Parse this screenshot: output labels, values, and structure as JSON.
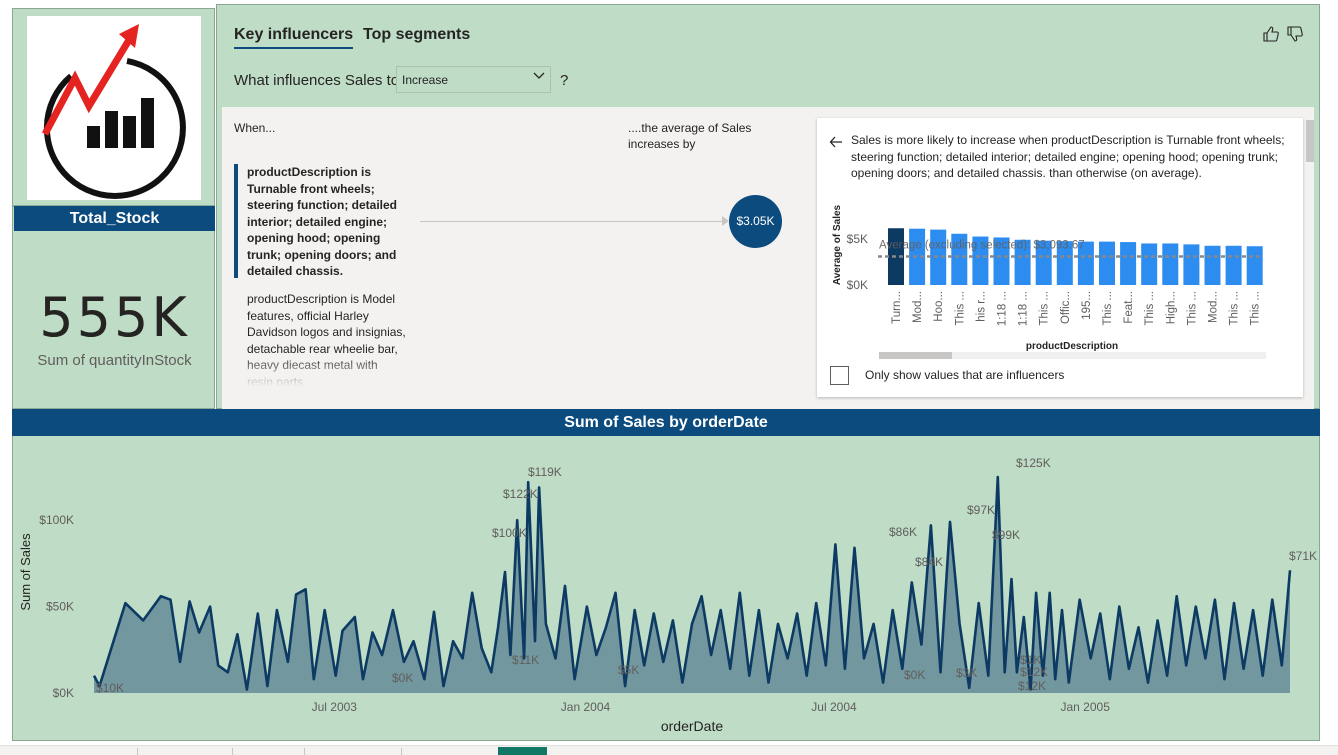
{
  "total_stock": {
    "title": "Total_Stock",
    "value": "555K",
    "label": "Sum of quantityInStock"
  },
  "key_influencers": {
    "tabs": [
      {
        "label": "Key influencers"
      },
      {
        "label": "Top segments"
      }
    ],
    "question_prefix": "What influences Sales to",
    "question_suffix": "?",
    "dropdown_value": "Increase",
    "when_label": "When...",
    "avg_label": "....the average of Sales increases by",
    "influencers": [
      {
        "text": "productDescription is Turnable front wheels; steering function; detailed interior; detailed engine; opening hood; opening trunk; opening doors; and detailed chassis.",
        "value": "$3.05K"
      },
      {
        "text": "productDescription is Model features, official Harley Davidson logos and insignias, detachable rear wheelie bar, heavy diecast metal with resin parts"
      }
    ],
    "detail": {
      "text": "Sales is more likely to increase when productDescription is Turnable front wheels; steering function; detailed interior; detailed engine; opening hood; opening trunk; opening doors; and detailed chassis. than otherwise (on average).",
      "checkbox_label": "Only show values that are influencers"
    }
  },
  "sales_chart": {
    "title": "Sum of Sales by orderDate"
  },
  "chart_data": [
    {
      "type": "bar",
      "ylabel": "Average of Sales",
      "xlabel": "productDescription",
      "ylim": [
        0,
        6500
      ],
      "yticks": [
        "$0K",
        "$5K"
      ],
      "reference_line": {
        "label": "Average (excluding selected): $3,093.67",
        "value": 3093.67
      },
      "categories": [
        "Turn...",
        "Mod...",
        "Hoo...",
        "This ...",
        "his r...",
        "1:18 ...",
        "1:18 ...",
        "This ...",
        "Offic...",
        "195...",
        "This ...",
        "Feat...",
        "This ...",
        "High...",
        "This ...",
        "Mod...",
        "This ...",
        "This ..."
      ],
      "values": [
        6150,
        6100,
        6000,
        5550,
        5250,
        5150,
        4900,
        4800,
        4750,
        4700,
        4700,
        4650,
        4500,
        4500,
        4400,
        4250,
        4250,
        4200
      ],
      "highlighted_index": 0,
      "colors": {
        "highlight": "#0c3a63",
        "bar": "#2d8cf0"
      }
    },
    {
      "type": "area",
      "title": "Sum of Sales by orderDate",
      "xlabel": "orderDate",
      "ylabel": "Sum of Sales",
      "ylim": [
        0,
        125000
      ],
      "yticks": [
        "$0K",
        "$50K",
        "$100K"
      ],
      "xticks": [
        "Jul 2003",
        "Jan 2004",
        "Jul 2004",
        "Jan 2005"
      ],
      "x_range": [
        "2003-01-06",
        "2005-05-31"
      ],
      "data_labels": [
        "$10K",
        "$0K",
        "$122K",
        "$119K",
        "$100K",
        "$11K",
        "$5K",
        "$86K",
        "$84K",
        "$97K",
        "$99K",
        "$0K",
        "$3K",
        "$125K",
        "$12K",
        "$12K",
        "$1K",
        "$71K"
      ],
      "series": [
        {
          "x": [
            "2003-01-06",
            "2003-01-10",
            "2003-01-29",
            "2003-02-11",
            "2003-02-24",
            "2003-03-03",
            "2003-03-10",
            "2003-03-17",
            "2003-03-24",
            "2003-04-01",
            "2003-04-07",
            "2003-04-14",
            "2003-04-21",
            "2003-04-28",
            "2003-05-06",
            "2003-05-13",
            "2003-05-20",
            "2003-05-28",
            "2003-06-03",
            "2003-06-10",
            "2003-06-16",
            "2003-06-24",
            "2003-07-02",
            "2003-07-07",
            "2003-07-16",
            "2003-07-22",
            "2003-07-29",
            "2003-08-05",
            "2003-08-13",
            "2003-08-21",
            "2003-08-28",
            "2003-09-05",
            "2003-09-12",
            "2003-09-19",
            "2003-09-26",
            "2003-10-03",
            "2003-10-10",
            "2003-10-17",
            "2003-10-24",
            "2003-10-29",
            "2003-11-03",
            "2003-11-07",
            "2003-11-12",
            "2003-11-17",
            "2003-11-20",
            "2003-11-25",
            "2003-11-28",
            "2003-12-03",
            "2003-12-10",
            "2003-12-17",
            "2003-12-24",
            "2004-01-02",
            "2004-01-09",
            "2004-01-16",
            "2004-01-23",
            "2004-01-30",
            "2004-02-06",
            "2004-02-13",
            "2004-02-20",
            "2004-02-27",
            "2004-03-05",
            "2004-03-12",
            "2004-03-19",
            "2004-03-26",
            "2004-04-02",
            "2004-04-09",
            "2004-04-16",
            "2004-04-23",
            "2004-04-30",
            "2004-05-07",
            "2004-05-14",
            "2004-05-21",
            "2004-05-28",
            "2004-06-04",
            "2004-06-11",
            "2004-06-18",
            "2004-06-25",
            "2004-07-02",
            "2004-07-09",
            "2004-07-16",
            "2004-07-23",
            "2004-07-30",
            "2004-08-06",
            "2004-08-13",
            "2004-08-20",
            "2004-08-27",
            "2004-09-03",
            "2004-09-10",
            "2004-09-17",
            "2004-09-24",
            "2004-10-01",
            "2004-10-08",
            "2004-10-15",
            "2004-10-22",
            "2004-10-29",
            "2004-11-03",
            "2004-11-08",
            "2004-11-12",
            "2004-11-17",
            "2004-11-22",
            "2004-11-26",
            "2004-12-01",
            "2004-12-06",
            "2004-12-10",
            "2004-12-15",
            "2004-12-20",
            "2004-12-28",
            "2005-01-05",
            "2005-01-12",
            "2005-01-19",
            "2005-01-26",
            "2005-02-02",
            "2005-02-09",
            "2005-02-16",
            "2005-02-23",
            "2005-03-02",
            "2005-03-09",
            "2005-03-16",
            "2005-03-23",
            "2005-03-30",
            "2005-04-06",
            "2005-04-13",
            "2005-04-20",
            "2005-04-27",
            "2005-05-04",
            "2005-05-11",
            "2005-05-18",
            "2005-05-25",
            "2005-05-31"
          ],
          "values": [
            10000,
            4000,
            52000,
            42000,
            56000,
            54000,
            18000,
            53000,
            35000,
            50000,
            16000,
            12000,
            34000,
            2000,
            46000,
            4000,
            48000,
            18000,
            57000,
            60000,
            8000,
            48000,
            10000,
            36000,
            44000,
            8000,
            35000,
            22000,
            48000,
            18000,
            30000,
            8000,
            47000,
            4000,
            30000,
            20000,
            58000,
            26000,
            12000,
            38000,
            70000,
            22000,
            100000,
            20000,
            122000,
            30000,
            119000,
            40000,
            20000,
            62000,
            8000,
            50000,
            22000,
            38000,
            58000,
            4000,
            48000,
            16000,
            46000,
            18000,
            42000,
            6000,
            40000,
            56000,
            22000,
            48000,
            14000,
            58000,
            10000,
            48000,
            6000,
            40000,
            20000,
            46000,
            10000,
            52000,
            16000,
            86000,
            14000,
            84000,
            20000,
            40000,
            6000,
            48000,
            14000,
            64000,
            28000,
            97000,
            12000,
            99000,
            40000,
            3000,
            52000,
            10000,
            125000,
            12000,
            66000,
            12000,
            44000,
            2000,
            58000,
            10000,
            58000,
            8000,
            48000,
            6000,
            54000,
            20000,
            46000,
            8000,
            50000,
            14000,
            38000,
            6000,
            42000,
            10000,
            56000,
            16000,
            50000,
            20000,
            54000,
            8000,
            52000,
            14000,
            48000,
            10000,
            54000,
            16000,
            71000
          ]
        }
      ],
      "colors": {
        "line": "#0c3a63",
        "fill": "#6f929d"
      }
    }
  ]
}
